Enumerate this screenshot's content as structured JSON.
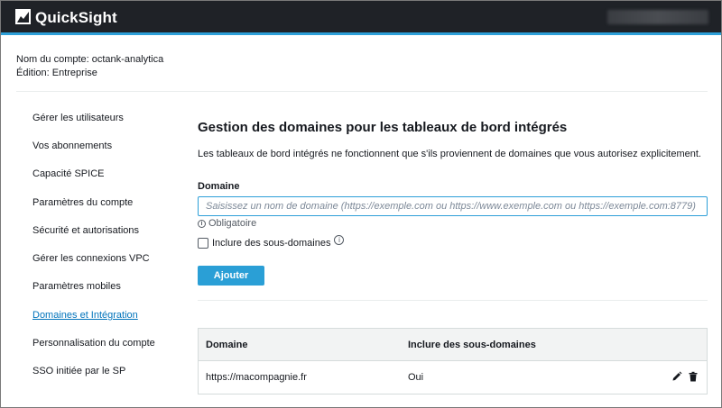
{
  "header": {
    "brand": "QuickSight"
  },
  "account": {
    "name_line": "Nom du compte: octank-analytica",
    "edition_line": "Édition: Entreprise"
  },
  "sidebar": {
    "items": [
      {
        "label": "Gérer les utilisateurs"
      },
      {
        "label": "Vos abonnements"
      },
      {
        "label": "Capacité SPICE"
      },
      {
        "label": "Paramètres du compte"
      },
      {
        "label": "Sécurité et autorisations"
      },
      {
        "label": "Gérer les connexions VPC"
      },
      {
        "label": "Paramètres mobiles"
      },
      {
        "label": "Domaines et Intégration"
      },
      {
        "label": "Personnalisation du compte"
      },
      {
        "label": "SSO initiée par le SP"
      }
    ],
    "active_label": "Domaines et Intégration"
  },
  "main": {
    "title": "Gestion des domaines pour les tableaux de bord intégrés",
    "description": "Les tableaux de bord intégrés ne fonctionnent que s'ils proviennent de domaines que vous autorisez explicitement.",
    "domain_label": "Domaine",
    "domain_placeholder": "Saisissez un nom de domaine (https://exemple.com ou https://www.exemple.com ou https://exemple.com:8779)",
    "domain_value": "",
    "required_text": "Obligatoire",
    "subdomains_checkbox_label": "Inclure des sous-domaines",
    "subdomains_checked": false,
    "add_button_label": "Ajouter"
  },
  "table": {
    "columns": [
      "Domaine",
      "Inclure des sous-domaines"
    ],
    "rows": [
      {
        "domain": "https://macompagnie.fr",
        "include_subdomains": "Oui"
      }
    ]
  },
  "icons": {
    "logo": "quicksight-logo-icon",
    "required_info": "info-icon",
    "subdomains_info": "info-icon",
    "edit": "pencil-icon",
    "delete": "trash-icon"
  },
  "colors": {
    "topbar_bg": "#1f2227",
    "accent": "#2a9fd6",
    "link_active": "#0073bb"
  }
}
